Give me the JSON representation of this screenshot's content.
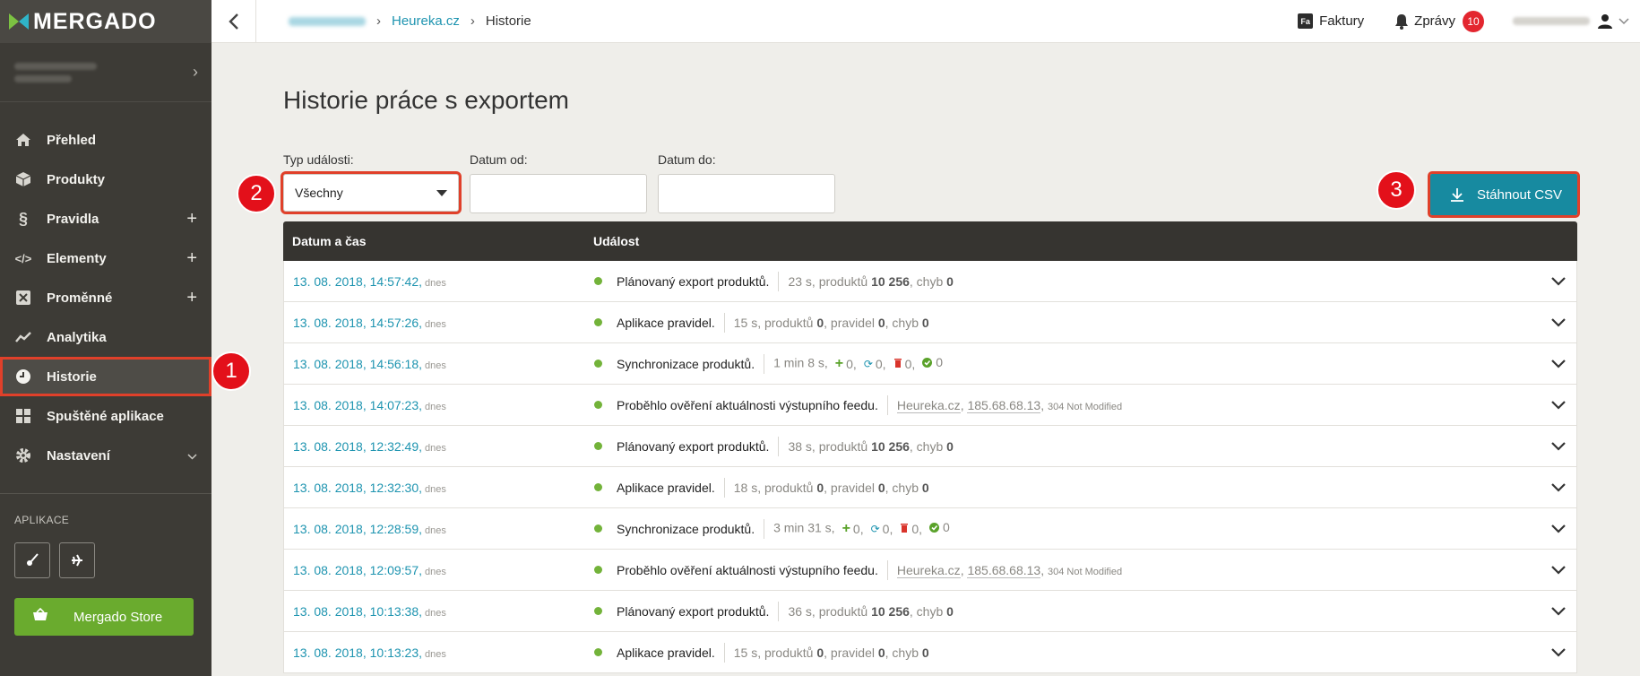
{
  "app": {
    "logo": "MERGADO"
  },
  "sidebar": {
    "items": [
      {
        "label": "Přehled",
        "icon": "home-icon",
        "extra": ""
      },
      {
        "label": "Produkty",
        "icon": "box-icon",
        "extra": ""
      },
      {
        "label": "Pravidla",
        "icon": "paragraph-icon",
        "extra": "+"
      },
      {
        "label": "Elementy",
        "icon": "code-icon",
        "extra": "+"
      },
      {
        "label": "Proměnné",
        "icon": "variable-icon",
        "extra": "+"
      },
      {
        "label": "Analytika",
        "icon": "chart-icon",
        "extra": ""
      },
      {
        "label": "Historie",
        "icon": "clock-icon",
        "extra": "",
        "active": true
      },
      {
        "label": "Spuštěné aplikace",
        "icon": "grid-icon",
        "extra": ""
      },
      {
        "label": "Nastavení",
        "icon": "gear-icon",
        "extra": "v"
      }
    ],
    "apps_heading": "APLIKACE",
    "store_label": "Mergado Store"
  },
  "annotations": {
    "one": "1",
    "two": "2",
    "three": "3"
  },
  "topbar": {
    "breadcrumb_link": "Heureka.cz",
    "breadcrumb_current": "Historie",
    "invoices": "Faktury",
    "messages": "Zprávy",
    "messages_count": "10"
  },
  "main": {
    "title": "Historie práce s exportem",
    "filter_type_label": "Typ události:",
    "filter_type_value": "Všechny",
    "filter_from_label": "Datum od:",
    "filter_to_label": "Datum do:",
    "csv_label": "Stáhnout CSV",
    "col_date": "Datum a čas",
    "col_event": "Událost",
    "today": "dnes"
  },
  "rows": [
    {
      "date": "13. 08. 2018, 14:57:42,",
      "event": "Plánovaný export produktů.",
      "type": "export",
      "time": "23 s, produktů ",
      "products": "10 256",
      "errors": "0"
    },
    {
      "date": "13. 08. 2018, 14:57:26,",
      "event": "Aplikace pravidel.",
      "type": "rules",
      "time": "15 s, produktů ",
      "products": "0",
      "rules": "0",
      "errors": "0"
    },
    {
      "date": "13. 08. 2018, 14:56:18,",
      "event": "Synchronizace produktů.",
      "type": "sync",
      "time": "1 min 8 s,",
      "added": "0,",
      "synced": "0,",
      "deleted": "0,",
      "ok": "0"
    },
    {
      "date": "13. 08. 2018, 14:07:23,",
      "event": "Proběhlo ověření aktuálnosti výstupního feedu.",
      "type": "check",
      "site": "Heureka.cz",
      "ip": "185.68.68.13",
      "status": "304 Not Modified"
    },
    {
      "date": "13. 08. 2018, 12:32:49,",
      "event": "Plánovaný export produktů.",
      "type": "export",
      "time": "38 s, produktů ",
      "products": "10 256",
      "errors": "0"
    },
    {
      "date": "13. 08. 2018, 12:32:30,",
      "event": "Aplikace pravidel.",
      "type": "rules",
      "time": "18 s, produktů ",
      "products": "0",
      "rules": "0",
      "errors": "0"
    },
    {
      "date": "13. 08. 2018, 12:28:59,",
      "event": "Synchronizace produktů.",
      "type": "sync",
      "time": "3 min 31 s,",
      "added": "0,",
      "synced": "0,",
      "deleted": "0,",
      "ok": "0"
    },
    {
      "date": "13. 08. 2018, 12:09:57,",
      "event": "Proběhlo ověření aktuálnosti výstupního feedu.",
      "type": "check",
      "site": "Heureka.cz",
      "ip": "185.68.68.13",
      "status": "304 Not Modified"
    },
    {
      "date": "13. 08. 2018, 10:13:38,",
      "event": "Plánovaný export produktů.",
      "type": "export",
      "time": "36 s, produktů ",
      "products": "10 256",
      "errors": "0"
    },
    {
      "date": "13. 08. 2018, 10:13:23,",
      "event": "Aplikace pravidel.",
      "type": "rules",
      "time": "15 s, produktů ",
      "products": "0",
      "rules": "0",
      "errors": "0"
    }
  ]
}
